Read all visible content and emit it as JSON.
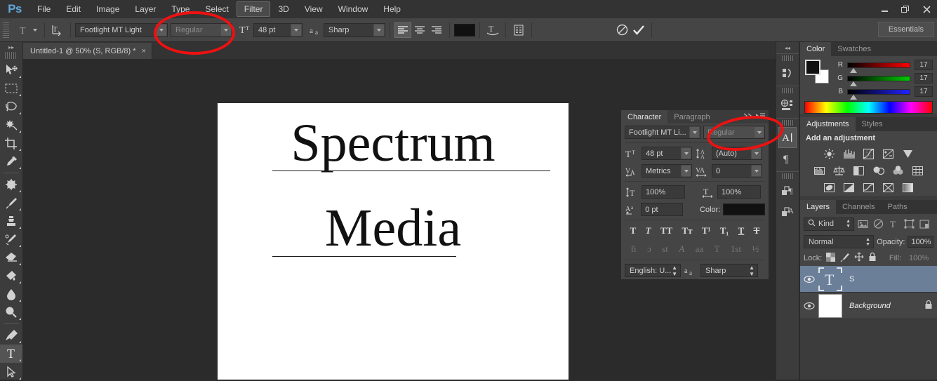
{
  "app": {
    "logo": "Ps",
    "menu": [
      "File",
      "Edit",
      "Image",
      "Layer",
      "Type",
      "Select",
      "Filter",
      "3D",
      "View",
      "Window",
      "Help"
    ],
    "menu_highlighted": "Filter",
    "workspace": "Essentials"
  },
  "options_bar": {
    "tool_icon": "type-tool-icon",
    "orientation_icon": "text-orientation-icon",
    "font_family": "Footlight MT Light",
    "font_style": "Regular",
    "font_style_disabled": true,
    "size_icon": "font-size-icon",
    "font_size": "48 pt",
    "aa_icon": "anti-alias-icon",
    "anti_alias": "Sharp",
    "align": [
      "align-left",
      "align-center",
      "align-right"
    ],
    "align_active": "align-left",
    "text_color": "#111111",
    "warp_icon": "warp-text-icon",
    "panels_icon": "toggle-panels-icon",
    "cancel_icon": "cancel-icon",
    "commit_icon": "commit-icon"
  },
  "toolbar": {
    "tools": [
      {
        "name": "move-tool",
        "glyph": "move"
      },
      {
        "name": "rectangular-marquee-tool",
        "glyph": "marquee"
      },
      {
        "name": "lasso-tool",
        "glyph": "lasso"
      },
      {
        "name": "quick-selection-tool",
        "glyph": "wand"
      },
      {
        "name": "crop-tool",
        "glyph": "crop"
      },
      {
        "name": "eyedropper-tool",
        "glyph": "eyedropper"
      },
      {
        "name": "spot-healing-brush-tool",
        "glyph": "heal"
      },
      {
        "name": "brush-tool",
        "glyph": "brush"
      },
      {
        "name": "clone-stamp-tool",
        "glyph": "stamp"
      },
      {
        "name": "history-brush-tool",
        "glyph": "historybrush"
      },
      {
        "name": "eraser-tool",
        "glyph": "eraser"
      },
      {
        "name": "gradient-tool",
        "glyph": "paintbucket"
      },
      {
        "name": "blur-tool",
        "glyph": "blur"
      },
      {
        "name": "dodge-tool",
        "glyph": "dodge"
      },
      {
        "name": "pen-tool",
        "glyph": "pen"
      },
      {
        "name": "horizontal-type-tool",
        "glyph": "type",
        "selected": true
      },
      {
        "name": "path-selection-tool",
        "glyph": "pathselect"
      }
    ]
  },
  "document_tab": {
    "title": "Untitled-1 @ 50% (S, RGB/8) *",
    "close": "×"
  },
  "canvas": {
    "text_line_1": "Spectrum",
    "text_line_2": "Media"
  },
  "icon_dock": {
    "collapse": "◂◂",
    "groups": [
      [
        {
          "name": "history-panel-icon"
        }
      ],
      [
        {
          "name": "3d-panel-icon"
        }
      ],
      [
        {
          "name": "character-panel-icon",
          "selected": true
        },
        {
          "name": "paragraph-panel-icon"
        }
      ],
      [
        {
          "name": "layer-comps-panel-icon"
        },
        {
          "name": "styles-panel-icon"
        }
      ]
    ]
  },
  "character_panel": {
    "tabs": [
      {
        "label": "Character",
        "active": true
      },
      {
        "label": "Paragraph",
        "active": false
      }
    ],
    "collapse_icon": "collapse-arrows-icon",
    "menu_icon": "panel-menu-icon",
    "font_family": "Footlight MT Li...",
    "font_style": "Regular",
    "font_style_disabled": true,
    "size_icon": "font-size-icon",
    "font_size": "48 pt",
    "leading_icon": "leading-icon",
    "leading": "(Auto)",
    "kerning_icon": "kerning-icon",
    "kerning": "Metrics",
    "tracking_icon": "tracking-icon",
    "tracking": "0",
    "vscale_icon": "vertical-scale-icon",
    "vertical_scale": "100%",
    "hscale_icon": "horizontal-scale-icon",
    "horizontal_scale": "100%",
    "baseline_icon": "baseline-shift-icon",
    "baseline_shift": "0 pt",
    "color_label": "Color:",
    "color_value": "#111111",
    "style_buttons": [
      {
        "name": "faux-bold",
        "glyph": "T",
        "enabled": true
      },
      {
        "name": "faux-italic",
        "glyph": "T",
        "enabled": true
      },
      {
        "name": "all-caps",
        "glyph": "TT",
        "enabled": true
      },
      {
        "name": "small-caps",
        "glyph": "Tᴛ",
        "enabled": true
      },
      {
        "name": "superscript",
        "glyph": "T¹",
        "enabled": true
      },
      {
        "name": "subscript",
        "glyph": "T₁",
        "enabled": true
      },
      {
        "name": "underline",
        "glyph": "T",
        "enabled": true
      },
      {
        "name": "strikethrough",
        "glyph": "T̶",
        "enabled": true
      }
    ],
    "opentype_buttons": [
      {
        "name": "standard-ligatures",
        "glyph": "fi"
      },
      {
        "name": "contextual-alternates",
        "glyph": "ɵ"
      },
      {
        "name": "discretionary-ligatures",
        "glyph": "st"
      },
      {
        "name": "swash",
        "glyph": "𝒜"
      },
      {
        "name": "stylistic-alternates",
        "glyph": "aa"
      },
      {
        "name": "titling-alternates",
        "glyph": "T"
      },
      {
        "name": "ordinals",
        "glyph": "1st"
      },
      {
        "name": "fractions",
        "glyph": "½"
      }
    ],
    "language": "English: U...",
    "aa_icon": "anti-alias-icon",
    "anti_alias": "Sharp"
  },
  "color_panel": {
    "tabs": [
      {
        "label": "Color",
        "active": true
      },
      {
        "label": "Swatches",
        "active": false
      }
    ],
    "foreground": "#111111",
    "background": "#ffffff",
    "channels": [
      {
        "label": "R",
        "value": "17",
        "accent": "#ff0000"
      },
      {
        "label": "G",
        "value": "17",
        "accent": "#00cc00"
      },
      {
        "label": "B",
        "value": "17",
        "accent": "#2222ff"
      }
    ]
  },
  "adjustments_panel": {
    "tabs": [
      {
        "label": "Adjustments",
        "active": true
      },
      {
        "label": "Styles",
        "active": false
      }
    ],
    "title": "Add an adjustment",
    "rows": [
      [
        "brightness-contrast-icon",
        "levels-icon",
        "curves-icon",
        "exposure-icon",
        "vibrance-icon"
      ],
      [
        "hue-saturation-icon",
        "color-balance-icon",
        "black-white-icon",
        "photo-filter-icon",
        "channel-mixer-icon",
        "color-lookup-icon"
      ],
      [
        "invert-icon",
        "posterize-icon",
        "threshold-icon",
        "selective-color-icon",
        "gradient-map-icon"
      ]
    ]
  },
  "layers_panel": {
    "tabs": [
      {
        "label": "Layers",
        "active": true
      },
      {
        "label": "Channels",
        "active": false
      },
      {
        "label": "Paths",
        "active": false
      }
    ],
    "filter_label": "Kind",
    "filter_icon": "search-icon",
    "filter_buttons": [
      "filter-pixel-icon",
      "filter-adjustment-icon",
      "filter-type-icon",
      "filter-shape-icon",
      "filter-smart-object-icon"
    ],
    "blend_mode": "Normal",
    "opacity_label": "Opacity:",
    "opacity_value": "100%",
    "lock_label": "Lock:",
    "lock_buttons": [
      "lock-transparent-icon",
      "lock-image-icon",
      "lock-position-icon",
      "lock-all-icon"
    ],
    "fill_label": "Fill:",
    "fill_value": "100%",
    "layers": [
      {
        "name": "S",
        "type": "text",
        "selected": true,
        "visible": true,
        "locked": false,
        "thumb_icon": "text-layer-thumb-icon"
      },
      {
        "name": "Background",
        "type": "background",
        "selected": false,
        "visible": true,
        "locked": true,
        "thumb_icon": "background-thumb-icon"
      }
    ]
  },
  "annotations": [
    {
      "name": "annotation-ellipse-options-bar-style",
      "color": "#ee1111"
    },
    {
      "name": "annotation-ellipse-character-panel-style",
      "color": "#ee1111"
    }
  ]
}
